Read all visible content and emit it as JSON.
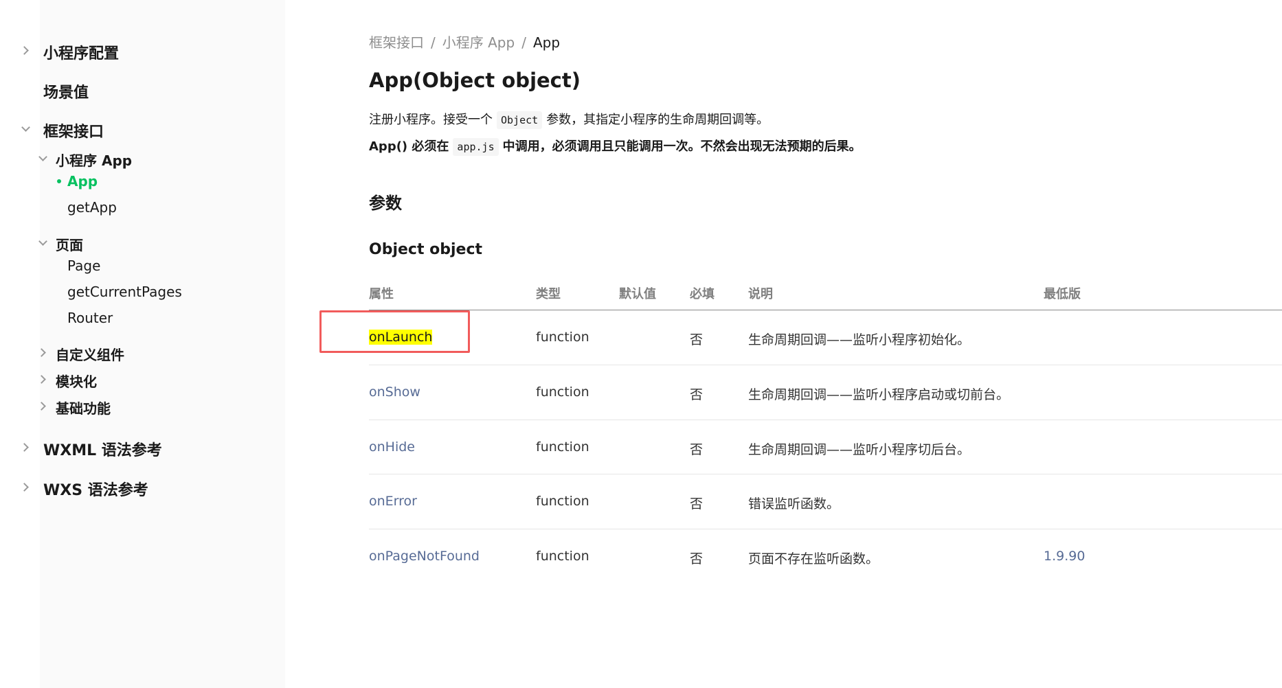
{
  "sidebar": {
    "items": [
      {
        "label": "小程序配置",
        "chevron": "right"
      },
      {
        "label": "场景值"
      },
      {
        "label": "框架接口",
        "chevron": "down"
      },
      {
        "label": "小程序 App",
        "chevron": "down"
      },
      {
        "label": "App",
        "active": true
      },
      {
        "label": "getApp"
      },
      {
        "label": "页面",
        "chevron": "down"
      },
      {
        "label": "Page"
      },
      {
        "label": "getCurrentPages"
      },
      {
        "label": "Router"
      },
      {
        "label": "自定义组件",
        "chevron": "right"
      },
      {
        "label": "模块化",
        "chevron": "right"
      },
      {
        "label": "基础功能",
        "chevron": "right"
      },
      {
        "label": "WXML 语法参考",
        "chevron": "right"
      },
      {
        "label": "WXS 语法参考",
        "chevron": "right"
      }
    ]
  },
  "breadcrumb": {
    "items": [
      "框架接口",
      "小程序 App",
      "App"
    ],
    "separator": "/"
  },
  "main": {
    "title": "App(Object object)",
    "desc1": {
      "before": "注册小程序。接受一个",
      "code": "Object",
      "after": "参数，其指定小程序的生命周期回调等。"
    },
    "desc2": {
      "before": "App() 必须在",
      "code": "app.js",
      "after": "中调用，必须调用且只能调用一次。不然会出现无法预期的后果。"
    },
    "section_heading": "参数",
    "subsection_heading": "Object object"
  },
  "table": {
    "headers": [
      "属性",
      "类型",
      "默认值",
      "必填",
      "说明",
      "最低版"
    ],
    "rows": [
      {
        "prop": "onLaunch",
        "type": "function",
        "default": "",
        "required": "否",
        "note": "生命周期回调——监听小程序初始化。",
        "version": "",
        "highlighted": true
      },
      {
        "prop": "onShow",
        "type": "function",
        "default": "",
        "required": "否",
        "note": "生命周期回调——监听小程序启动或切前台。",
        "version": ""
      },
      {
        "prop": "onHide",
        "type": "function",
        "default": "",
        "required": "否",
        "note": "生命周期回调——监听小程序切后台。",
        "version": ""
      },
      {
        "prop": "onError",
        "type": "function",
        "default": "",
        "required": "否",
        "note": "错误监听函数。",
        "version": ""
      },
      {
        "prop": "onPageNotFound",
        "type": "function",
        "default": "",
        "required": "否",
        "note": "页面不存在监听函数。",
        "version": "1.9.90"
      }
    ]
  },
  "colors": {
    "accent": "#07c160",
    "link": "#576b95",
    "highlight": "#ffff00",
    "annotation_box": "#f15b5b"
  }
}
